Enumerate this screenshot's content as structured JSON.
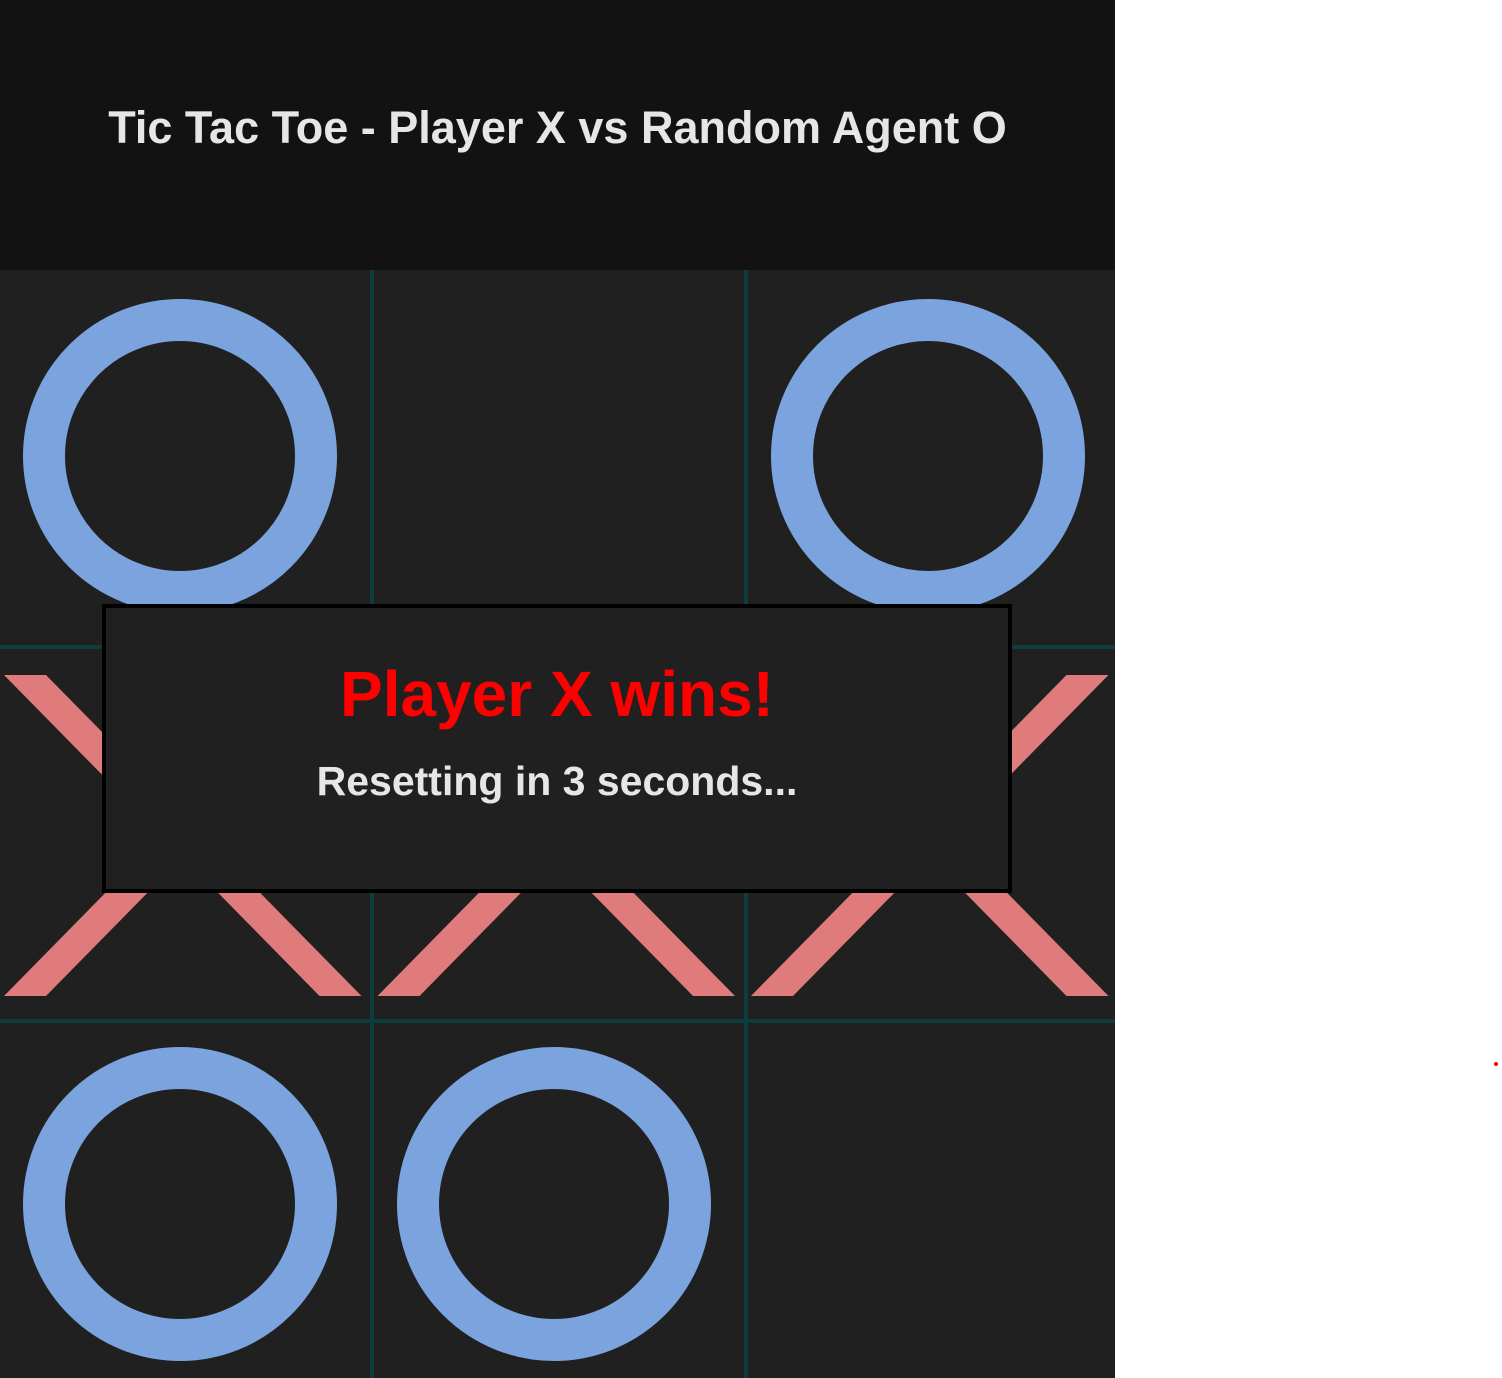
{
  "header": {
    "title": "Tic Tac Toe - Player X vs Random Agent O"
  },
  "board": {
    "cells": [
      [
        "O",
        "",
        "O"
      ],
      [
        "X",
        "X",
        "X"
      ],
      [
        "O",
        "O",
        ""
      ]
    ]
  },
  "result": {
    "message": "Player X wins!",
    "countdown": "Resetting in 3 seconds..."
  },
  "colors": {
    "x_mark": "#df7b7b",
    "o_mark": "#7ba3de",
    "grid_line": "#0d3d3d",
    "win_text": "#ff0000"
  }
}
